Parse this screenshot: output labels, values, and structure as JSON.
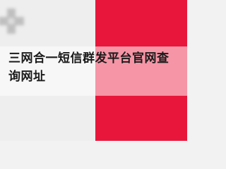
{
  "article": {
    "title": "三网合一短信群发平台官网查询网址"
  },
  "icons": {
    "background_logo": "blurred-logo-icon"
  },
  "colors": {
    "right_panel": "#e8163a",
    "left_panel": "#eeeeee",
    "title_text": "#1a1a1a"
  }
}
